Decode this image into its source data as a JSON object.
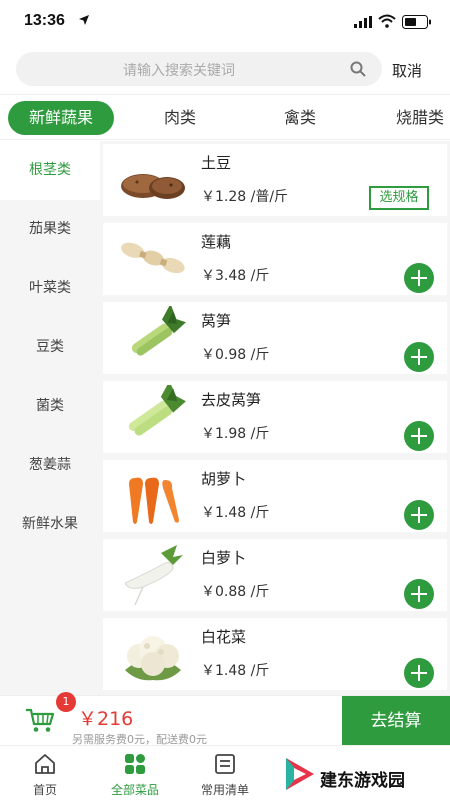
{
  "status": {
    "time": "13:36"
  },
  "search": {
    "placeholder": "请输入搜索关键词",
    "cancel_label": "取消"
  },
  "tabs": [
    {
      "label": "新鲜蔬果",
      "active": true
    },
    {
      "label": "肉类"
    },
    {
      "label": "禽类"
    },
    {
      "label": "烧腊类"
    }
  ],
  "sidebar": {
    "items": [
      {
        "label": "根茎类",
        "active": true
      },
      {
        "label": "茄果类"
      },
      {
        "label": "叶菜类"
      },
      {
        "label": "豆类"
      },
      {
        "label": "菌类"
      },
      {
        "label": "葱姜蒜"
      },
      {
        "label": "新鲜水果"
      }
    ]
  },
  "products": [
    {
      "name": "土豆",
      "price": "￥1.28 /普/斤",
      "action": "选规格",
      "icon": "potato"
    },
    {
      "name": "莲藕",
      "price": "￥3.48 /斤",
      "icon": "lotus-root"
    },
    {
      "name": "莴笋",
      "price": "￥0.98 /斤",
      "icon": "lettuce-stem"
    },
    {
      "name": "去皮莴笋",
      "price": "￥1.98 /斤",
      "icon": "lettuce-stem"
    },
    {
      "name": "胡萝卜",
      "price": "￥1.48 /斤",
      "icon": "carrot"
    },
    {
      "name": "白萝卜",
      "price": "￥0.88 /斤",
      "icon": "white-radish"
    },
    {
      "name": "白花菜",
      "price": "￥1.48 /斤",
      "icon": "cauliflower"
    }
  ],
  "cart": {
    "badge": "1",
    "total": "￥216",
    "note": "另需服务费0元，配送费0元",
    "checkout_label": "去结算"
  },
  "nav": {
    "items": [
      {
        "label": "首页",
        "icon": "home-icon"
      },
      {
        "label": "全部菜品",
        "icon": "grid-icon",
        "active": true
      },
      {
        "label": "常用清单",
        "icon": "list-icon"
      }
    ]
  },
  "watermark": {
    "text": "建东游戏园"
  },
  "colors": {
    "accent": "#2f9b3f",
    "price_red": "#e53935"
  }
}
